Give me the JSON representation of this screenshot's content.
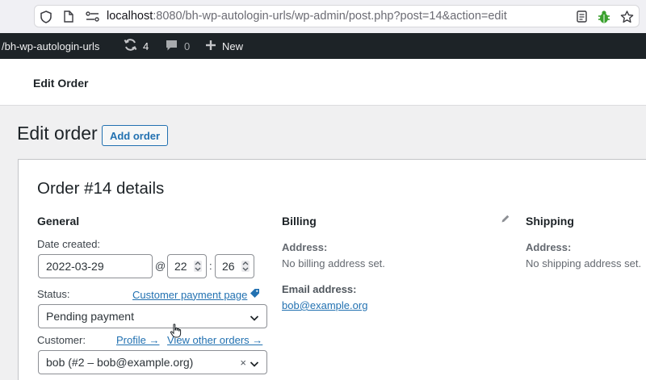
{
  "browser": {
    "url_host": "localhost",
    "url_rest": ":8080/bh-wp-autologin-urls/wp-admin/post.php?post=14&action=edit"
  },
  "admin_bar": {
    "site_name": "/bh-wp-autologin-urls",
    "updates_count": "4",
    "comments_count": "0",
    "new_label": "New"
  },
  "header": {
    "title": "Edit Order"
  },
  "page": {
    "title": "Edit order",
    "add_order_label": "Add order"
  },
  "order": {
    "heading": "Order #14 details",
    "general": {
      "title": "General",
      "date_label": "Date created:",
      "date_value": "2022-03-29",
      "at_sign": "@",
      "hour_value": "22",
      "minute_value": "26",
      "colon": ":",
      "status_label": "Status:",
      "customer_payment_page_link": "Customer payment page",
      "status_value": "Pending payment",
      "customer_label": "Customer:",
      "profile_link": "Profile →",
      "view_other_orders_link": "View other orders →",
      "customer_value": "bob (#2 – bob@example.org)",
      "clear_symbol": "×"
    },
    "billing": {
      "title": "Billing",
      "address_label": "Address:",
      "address_value": "No billing address set.",
      "email_label": "Email address:",
      "email_value": "bob@example.org"
    },
    "shipping": {
      "title": "Shipping",
      "address_label": "Address:",
      "address_value": "No shipping address set."
    }
  }
}
